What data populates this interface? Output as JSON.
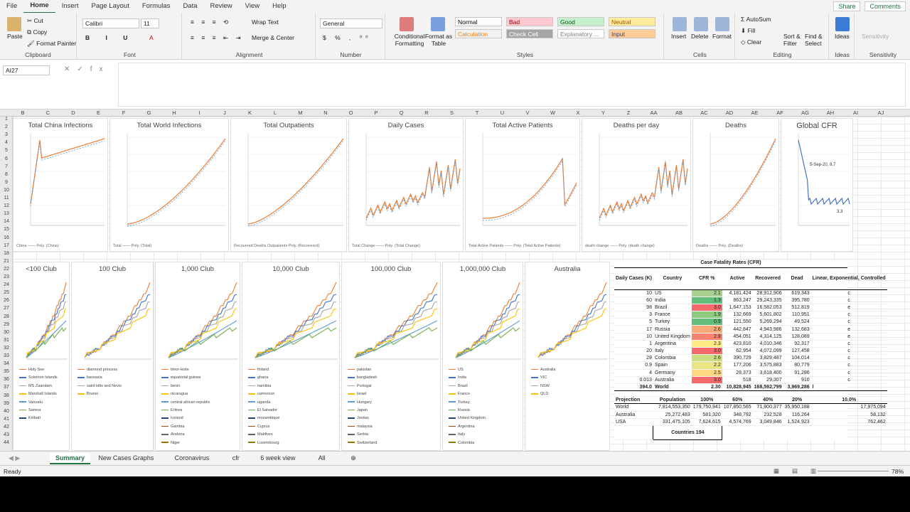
{
  "menu": {
    "tabs": [
      "File",
      "Home",
      "Insert",
      "Page Layout",
      "Formulas",
      "Data",
      "Review",
      "View",
      "Help"
    ],
    "active": "Home",
    "share": "Share",
    "comments": "Comments"
  },
  "ribbon": {
    "clipboard": {
      "label": "Clipboard",
      "paste": "Paste",
      "cut": "Cut",
      "copy": "Copy",
      "format_painter": "Format Painter"
    },
    "font": {
      "label": "Font",
      "name": "Calibri",
      "size": "11"
    },
    "alignment": {
      "label": "Alignment",
      "wrap": "Wrap Text",
      "merge": "Merge & Center"
    },
    "number": {
      "label": "Number",
      "format": "General"
    },
    "styles": {
      "label": "Styles",
      "conditional": "Conditional Formatting",
      "format_table": "Format as Table",
      "items": [
        [
          "Normal",
          "#ffffff",
          "#000000"
        ],
        [
          "Bad",
          "#ffc7ce",
          "#9c0006"
        ],
        [
          "Good",
          "#c6efce",
          "#006100"
        ],
        [
          "Neutral",
          "#ffeb9c",
          "#9c5700"
        ],
        [
          "Calculation",
          "#f2f2f2",
          "#fa7d00"
        ],
        [
          "Check Cell",
          "#a5a5a5",
          "#ffffff"
        ],
        [
          "Explanatory ...",
          "#ffffff",
          "#7f7f7f"
        ],
        [
          "Input",
          "#ffcc99",
          "#3f3f76"
        ]
      ]
    },
    "cells": {
      "label": "Cells",
      "insert": "Insert",
      "delete": "Delete",
      "format": "Format"
    },
    "editing": {
      "label": "Editing",
      "autosum": "AutoSum",
      "fill": "Fill",
      "clear": "Clear",
      "sort": "Sort & Filter",
      "find": "Find & Select"
    },
    "ideas": {
      "label": "Ideas",
      "btn": "Ideas"
    },
    "sensitivity": {
      "label": "Sensitivity",
      "btn": "Sensitivity"
    }
  },
  "formula_bar": {
    "namebox": "AI27",
    "fx": "fx",
    "content": ""
  },
  "columns": [
    "B",
    "C",
    "D",
    "E",
    "F",
    "G",
    "H",
    "I",
    "J",
    "K",
    "L",
    "M",
    "N",
    "O",
    "P",
    "Q",
    "R",
    "S",
    "T",
    "U",
    "V",
    "W",
    "X",
    "Y",
    "Z",
    "AA",
    "AB",
    "AC",
    "AD",
    "AE",
    "AF",
    "AG",
    "AH",
    "AI",
    "AJ"
  ],
  "rows": [
    "1",
    "2",
    "3",
    "4",
    "5",
    "6",
    "7",
    "8",
    "9",
    "10",
    "11",
    "12",
    "13",
    "14",
    "15",
    "16",
    "17",
    "18",
    "21",
    "22",
    "23",
    "24",
    "25",
    "26",
    "27",
    "28",
    "29",
    "30",
    "31",
    "32",
    "33",
    "34",
    "35",
    "36",
    "37",
    "38",
    "39",
    "40",
    "41",
    "42",
    "43",
    "44"
  ],
  "charts_top": [
    {
      "title": "Total China Infections",
      "legend": "China  —— Poly. (China)"
    },
    {
      "title": "Total World Infections",
      "legend": "Total  —— Poly. (Total)"
    },
    {
      "title": "Total Outpatients",
      "legend": "Recovered  Deaths  Outpatients  Poly. (Recovered)"
    },
    {
      "title": "Daily Cases",
      "legend": "Total Change  —— Poly. (Total Change)"
    },
    {
      "title": "Total Active Patients",
      "legend": "Total Active Patients  —— Poly. (Total Active Patients)"
    },
    {
      "title": "Deaths per day",
      "legend": "death change  —— Poly. (death change)"
    },
    {
      "title": "Deaths",
      "legend": "Deaths  —— Poly. (Deaths)"
    },
    {
      "title": "Global CFR",
      "legend": ""
    }
  ],
  "charts_bottom": [
    {
      "title": "<100 Club",
      "legend": [
        "Holy See",
        "Solomon Islands",
        "MS Zaandam",
        "Marshall Islands",
        "Vanuatu",
        "Samoa",
        "Kiribati"
      ]
    },
    {
      "title": "100 Club",
      "legend": [
        "diamond princess",
        "bassaxia",
        "saint kitts and Nevis",
        "Brunei"
      ]
    },
    {
      "title": "1,000 Club",
      "legend": [
        "timor-leste",
        "equatorial guinea",
        "benin",
        "nicaragua",
        "central african republic",
        "Eritrea",
        "Iceland",
        "Gambia",
        "Andorra",
        "Niger"
      ]
    },
    {
      "title": "10,000 Club",
      "legend": [
        "finland",
        "ghana",
        "namibia",
        "cameroon",
        "uganda",
        "El Salvador",
        "mozambique",
        "Cyprus",
        "Maldives",
        "Luxembourg"
      ]
    },
    {
      "title": "100,000 Club",
      "legend": [
        "pakistan",
        "bangladesh",
        "Portugal",
        "Israel",
        "Hungary",
        "Japan",
        "Jordan",
        "malaysia",
        "Serbia",
        "Switzerland"
      ]
    },
    {
      "title": "1,000,000 Club",
      "legend": [
        "US",
        "India",
        "Brazil",
        "France",
        "Turkey",
        "Russia",
        "United Kingdom",
        "Argentina",
        "Italy",
        "Colombia"
      ]
    },
    {
      "title": "Australia",
      "legend": [
        "Australia",
        "VIC",
        "NSW",
        "QLD"
      ]
    }
  ],
  "global_cfr_annotations": [
    "5-Sep-20, 8.7",
    "3.3"
  ],
  "cfr_table": {
    "title": "Case Fatality Rates (CFR)",
    "headers": [
      "Daily Cases (K)",
      "Country",
      "CFR %",
      "Active",
      "Recovered",
      "Dead",
      "Linear, Exponential, Controlled"
    ],
    "rows": [
      [
        "10",
        "US",
        "2.1",
        "4,181,424",
        "28,912,906",
        "619,343",
        "c",
        "#a9d08e"
      ],
      [
        "60",
        "India",
        "1.3",
        "863,247",
        "29,243,335",
        "395,780",
        "c",
        "#63be7b"
      ],
      [
        "98",
        "Brazil",
        "3.0",
        "1,647,153",
        "16,582,053",
        "512,819",
        "e",
        "#f8696b"
      ],
      [
        "3",
        "France",
        "1.9",
        "132,669",
        "5,601,802",
        "110,951",
        "c",
        "#8ccb7e"
      ],
      [
        "5",
        "Turkey",
        "0.9",
        "121,550",
        "5,269,294",
        "49,524",
        "c",
        "#63be7b"
      ],
      [
        "17",
        "Russia",
        "2.6",
        "442,847",
        "4,943,986",
        "132,683",
        "e",
        "#fbaa77"
      ],
      [
        "10",
        "United Kingdom",
        "2.9",
        "454,051",
        "4,314,125",
        "128,089",
        "e",
        "#f98370"
      ],
      [
        "1",
        "Argentina",
        "2.3",
        "423,810",
        "4,010,346",
        "92,317",
        "c",
        "#ffeb84"
      ],
      [
        "20",
        "Italy",
        "3.0",
        "62,954",
        "4,072,099",
        "127,458",
        "c",
        "#f8696b"
      ],
      [
        "28",
        "Colombia",
        "2.6",
        "390,729",
        "3,829,487",
        "104,014",
        "c",
        "#cddd82"
      ],
      [
        "0.9",
        "Spain",
        "2.2",
        "177,206",
        "3,575,883",
        "80,779",
        "c",
        "#e9e583"
      ],
      [
        "4",
        "Germany",
        "2.5",
        "28,373",
        "3,618,400",
        "91,286",
        "c",
        "#fed880"
      ],
      [
        "0.013",
        "Australia",
        "3.0",
        "518",
        "29,307",
        "910",
        "c",
        "#f8696b"
      ]
    ],
    "world": [
      "394.0",
      "World",
      "2.30",
      "10,828,945",
      "168,592,799",
      "3,969,286",
      "l"
    ],
    "projection_headers": [
      "Projection",
      "Population",
      "100%",
      "60%",
      "40%",
      "20%",
      "10.0%"
    ],
    "projection": [
      [
        "World",
        "7,814,553,350",
        "179,750,941",
        "107,850,565",
        "71,900,377",
        "35,950,188",
        "17,975,094"
      ],
      [
        "Australia",
        "25,272,483",
        "581,320",
        "348,792",
        "232,528",
        "116,264",
        "58,132"
      ],
      [
        "USA",
        "331,475,105",
        "7,624,615",
        "4,574,769",
        "3,049,846",
        "1,524,923",
        "762,462"
      ]
    ],
    "countries": "Countries 194"
  },
  "sheet_tabs": [
    "Summary",
    "New Cases Graphs",
    "Coronavirus",
    "cfr",
    "6 week view",
    "All"
  ],
  "active_sheet": "Summary",
  "status": {
    "ready": "Ready",
    "zoom": "78%"
  }
}
